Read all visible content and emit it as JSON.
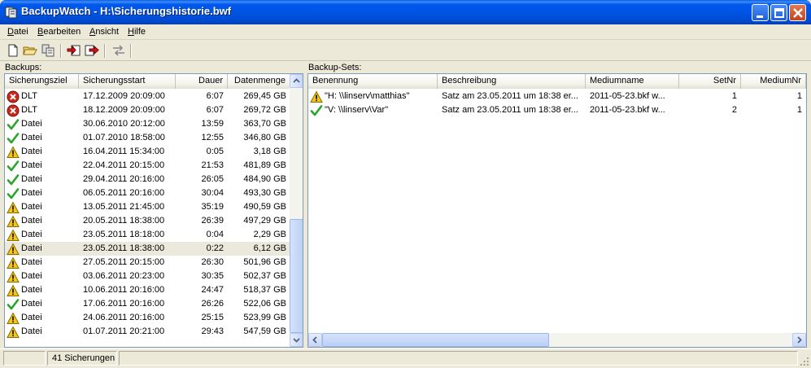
{
  "window": {
    "title": "BackupWatch - H:\\Sicherungshistorie.bwf",
    "app_icon": "app-icon",
    "controls": [
      "minimize-icon",
      "maximize-icon",
      "close-icon"
    ]
  },
  "menu": [
    {
      "label": "Datei",
      "mnemonic": "D",
      "rest": "atei"
    },
    {
      "label": "Bearbeiten",
      "mnemonic": "B",
      "rest": "earbeiten"
    },
    {
      "label": "Ansicht",
      "mnemonic": "A",
      "rest": "nsicht"
    },
    {
      "label": "Hilfe",
      "mnemonic": "H",
      "rest": "ilfe"
    }
  ],
  "toolbar": [
    "new-file-icon",
    "open-folder-icon",
    "properties-icon",
    "import-icon",
    "export-icon",
    "compare-icon"
  ],
  "backups": {
    "label": "Backups:",
    "columns": [
      "Sicherungsziel",
      "Sicherungsstart",
      "Dauer",
      "Datenmenge"
    ],
    "rows": [
      {
        "status": "error",
        "target": "DLT",
        "start": "17.12.2009 20:09:00",
        "duration": "6:07",
        "size": "269,45 GB"
      },
      {
        "status": "error",
        "target": "DLT",
        "start": "18.12.2009 20:09:00",
        "duration": "6:07",
        "size": "269,72 GB"
      },
      {
        "status": "ok",
        "target": "Datei",
        "start": "30.06.2010 20:12:00",
        "duration": "13:59",
        "size": "363,70 GB"
      },
      {
        "status": "ok",
        "target": "Datei",
        "start": "01.07.2010 18:58:00",
        "duration": "12:55",
        "size": "346,80 GB"
      },
      {
        "status": "warn",
        "target": "Datei",
        "start": "16.04.2011 15:34:00",
        "duration": "0:05",
        "size": "3,18 GB"
      },
      {
        "status": "ok",
        "target": "Datei",
        "start": "22.04.2011 20:15:00",
        "duration": "21:53",
        "size": "481,89 GB"
      },
      {
        "status": "ok",
        "target": "Datei",
        "start": "29.04.2011 20:16:00",
        "duration": "26:05",
        "size": "484,90 GB"
      },
      {
        "status": "ok",
        "target": "Datei",
        "start": "06.05.2011 20:16:00",
        "duration": "30:04",
        "size": "493,30 GB"
      },
      {
        "status": "warn",
        "target": "Datei",
        "start": "13.05.2011 21:45:00",
        "duration": "35:19",
        "size": "490,59 GB"
      },
      {
        "status": "warn",
        "target": "Datei",
        "start": "20.05.2011 18:38:00",
        "duration": "26:39",
        "size": "497,29 GB"
      },
      {
        "status": "warn",
        "target": "Datei",
        "start": "23.05.2011 18:18:00",
        "duration": "0:04",
        "size": "2,29 GB"
      },
      {
        "status": "warn",
        "target": "Datei",
        "start": "23.05.2011 18:38:00",
        "duration": "0:22",
        "size": "6,12 GB",
        "selected": true
      },
      {
        "status": "warn",
        "target": "Datei",
        "start": "27.05.2011 20:15:00",
        "duration": "26:30",
        "size": "501,96 GB"
      },
      {
        "status": "warn",
        "target": "Datei",
        "start": "03.06.2011 20:23:00",
        "duration": "30:35",
        "size": "502,37 GB"
      },
      {
        "status": "warn",
        "target": "Datei",
        "start": "10.06.2011 20:16:00",
        "duration": "24:47",
        "size": "518,37 GB"
      },
      {
        "status": "ok",
        "target": "Datei",
        "start": "17.06.2011 20:16:00",
        "duration": "26:26",
        "size": "522,06 GB"
      },
      {
        "status": "warn",
        "target": "Datei",
        "start": "24.06.2011 20:16:00",
        "duration": "25:15",
        "size": "523,99 GB"
      },
      {
        "status": "warn",
        "target": "Datei",
        "start": "01.07.2011 20:21:00",
        "duration": "29:43",
        "size": "547,59 GB"
      }
    ]
  },
  "backup_sets": {
    "label": "Backup-Sets:",
    "columns": [
      "Benennung",
      "Beschreibung",
      "Mediumname",
      "SetNr",
      "MediumNr"
    ],
    "rows": [
      {
        "status": "warn",
        "name": "\"H: \\\\linserv\\matthias\"",
        "description": "Satz am 23.05.2011 um 18:38 er...",
        "medium": "2011-05-23.bkf w...",
        "set": "1",
        "medium_nr": "1"
      },
      {
        "status": "ok",
        "name": "\"V: \\\\linserv\\Var\"",
        "description": "Satz am 23.05.2011 um 18:38 er...",
        "medium": "2011-05-23.bkf w...",
        "set": "2",
        "medium_nr": "1"
      }
    ]
  },
  "status": {
    "count": "41 Sicherungen"
  },
  "colors": {
    "title_blue": "#0054e3",
    "ok": "#2aa52a",
    "warn": "#f5c518",
    "error": "#c8281e",
    "selected_row": "#ebe8dc"
  }
}
